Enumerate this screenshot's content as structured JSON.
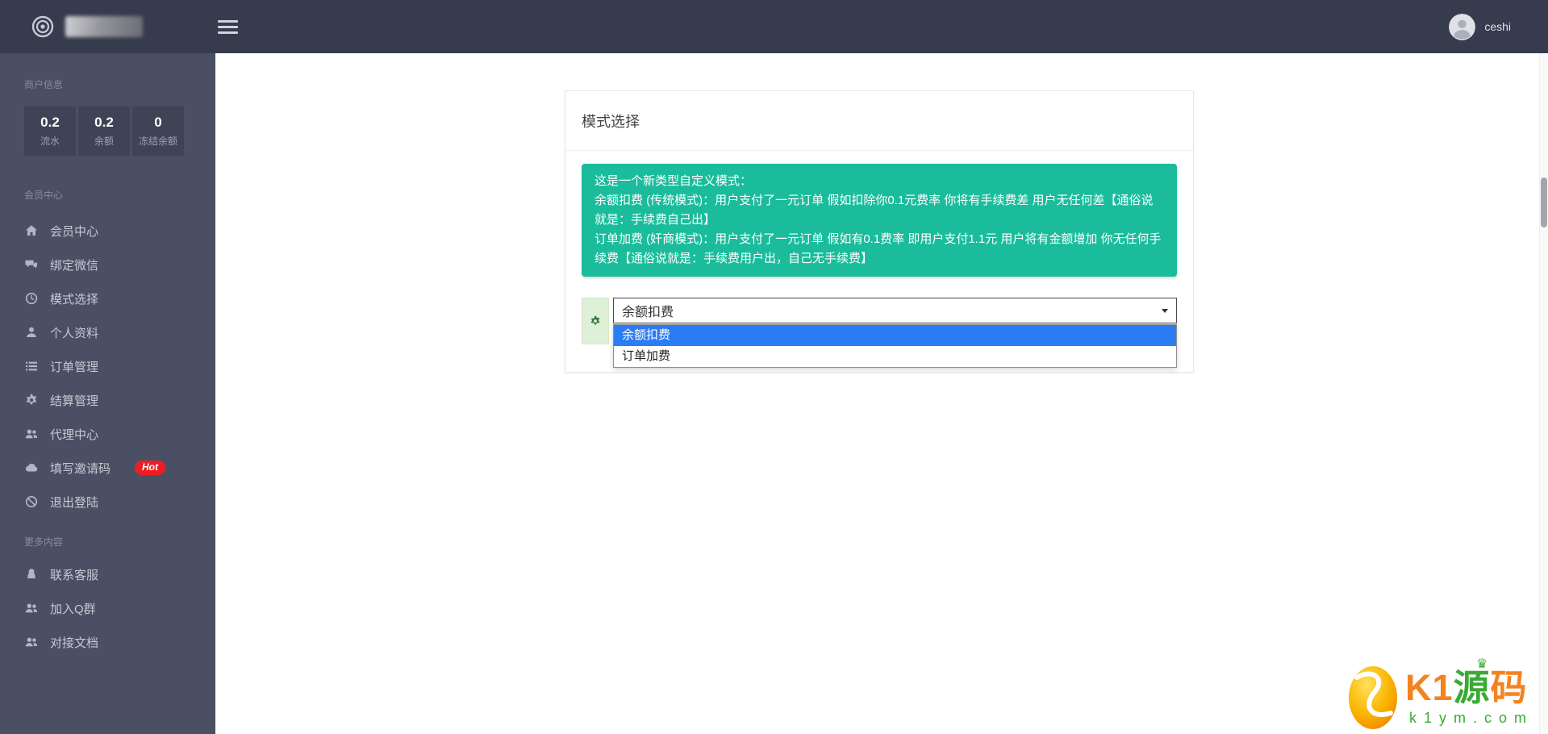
{
  "topbar": {
    "logo_icon": "bullseye-icon",
    "menu_icon": "hamburger-icon",
    "username": "ceshi"
  },
  "sidebar": {
    "section_merchant": "商户信息",
    "stats": [
      {
        "value": "0.2",
        "label": "流水"
      },
      {
        "value": "0.2",
        "label": "余额"
      },
      {
        "value": "0",
        "label": "冻结余额"
      }
    ],
    "section_member": "会员中心",
    "member_items": [
      {
        "label": "会员中心",
        "icon": "home-icon"
      },
      {
        "label": "绑定微信",
        "icon": "comments-icon"
      },
      {
        "label": "模式选择",
        "icon": "clock-icon"
      },
      {
        "label": "个人资料",
        "icon": "user-icon"
      },
      {
        "label": "订单管理",
        "icon": "list-icon"
      },
      {
        "label": "结算管理",
        "icon": "cogs-icon"
      },
      {
        "label": "代理中心",
        "icon": "users-icon"
      },
      {
        "label": "填写邀请码",
        "icon": "cloud-icon",
        "badge": "Hot"
      },
      {
        "label": "退出登陆",
        "icon": "ban-icon"
      }
    ],
    "section_more": "更多内容",
    "more_items": [
      {
        "label": "联系客服",
        "icon": "qq-icon"
      },
      {
        "label": "加入Q群",
        "icon": "users-icon"
      },
      {
        "label": "对接文档",
        "icon": "users-icon"
      }
    ]
  },
  "main": {
    "card_title": "模式选择",
    "notice_lines": [
      "这是一个新类型自定义模式：",
      "余额扣费 (传统模式)：用户支付了一元订单 假如扣除你0.1元费率 你将有手续费差 用户无任何差【通俗说就是：手续费自己出】",
      "订单加费 (奸商模式)：用户支付了一元订单 假如有0.1费率 即用户支付1.1元 用户将有金额增加 你无任何手续费【通俗说就是：手续费用户出，自己无手续费】"
    ],
    "select": {
      "value": "余额扣费",
      "options": [
        "余额扣费",
        "订单加费"
      ],
      "selected_index": 0,
      "gear_icon": "gear-icon"
    }
  },
  "watermark": {
    "k1": "K1",
    "yuan": "源",
    "ma": "码",
    "crown": "♛",
    "domain": "k1ym.com"
  },
  "colors": {
    "topbar_bg": "#363b4d",
    "sidebar_bg": "#4a4f63",
    "stat_box_bg": "#3e4355",
    "notice_green": "#1abc9c",
    "option_highlight_blue": "#2b7cf5",
    "hot_badge_red": "#ee1d23",
    "addon_bg_green": "#dff0d8",
    "watermark_orange": "#f58220",
    "watermark_green": "#3aaa35"
  }
}
